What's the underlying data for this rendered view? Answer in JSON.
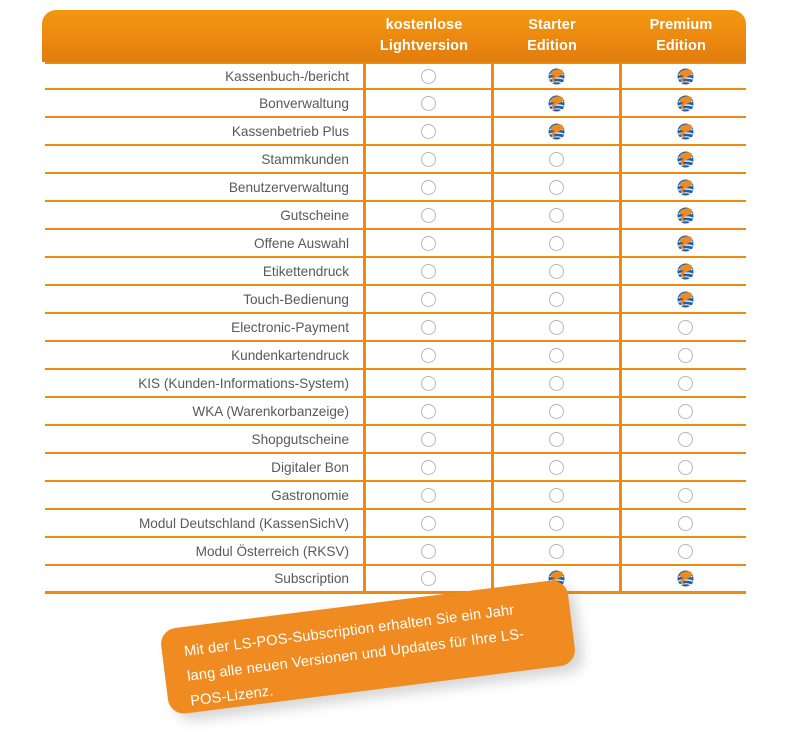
{
  "table": {
    "columns": [
      {
        "id": "feature",
        "label_lines": []
      },
      {
        "id": "light",
        "label_lines": [
          "kostenlose",
          "Lightversion"
        ]
      },
      {
        "id": "starter",
        "label_lines": [
          "Starter",
          "Edition"
        ]
      },
      {
        "id": "premium",
        "label_lines": [
          "Premium",
          "Edition"
        ]
      }
    ],
    "header": {
      "light_line1": "kostenlose",
      "light_line2": "Lightversion",
      "starter_line1": "Starter",
      "starter_line2": "Edition",
      "premium_line1": "Premium",
      "premium_line2": "Edition"
    },
    "marker_icons": {
      "included": "globe-icon",
      "not_included": "empty-circle-icon"
    },
    "rows": [
      {
        "feature": "Kassenbuch-/bericht",
        "light": false,
        "starter": true,
        "premium": true
      },
      {
        "feature": "Bonverwaltung",
        "light": false,
        "starter": true,
        "premium": true
      },
      {
        "feature": "Kassenbetrieb Plus",
        "light": false,
        "starter": true,
        "premium": true
      },
      {
        "feature": "Stammkunden",
        "light": false,
        "starter": false,
        "premium": true
      },
      {
        "feature": "Benutzerverwaltung",
        "light": false,
        "starter": false,
        "premium": true
      },
      {
        "feature": "Gutscheine",
        "light": false,
        "starter": false,
        "premium": true
      },
      {
        "feature": "Offene Auswahl",
        "light": false,
        "starter": false,
        "premium": true
      },
      {
        "feature": "Etikettendruck",
        "light": false,
        "starter": false,
        "premium": true
      },
      {
        "feature": "Touch-Bedienung",
        "light": false,
        "starter": false,
        "premium": true
      },
      {
        "feature": "Electronic-Payment",
        "light": false,
        "starter": false,
        "premium": false
      },
      {
        "feature": "Kundenkartendruck",
        "light": false,
        "starter": false,
        "premium": false
      },
      {
        "feature": "KIS (Kunden-Informations-System)",
        "light": false,
        "starter": false,
        "premium": false
      },
      {
        "feature": "WKA (Warenkorbanzeige)",
        "light": false,
        "starter": false,
        "premium": false
      },
      {
        "feature": "Shopgutscheine",
        "light": false,
        "starter": false,
        "premium": false
      },
      {
        "feature": "Digitaler Bon",
        "light": false,
        "starter": false,
        "premium": false
      },
      {
        "feature": "Gastronomie",
        "light": false,
        "starter": false,
        "premium": false
      },
      {
        "feature": "Modul Deutschland (KassenSichV)",
        "light": false,
        "starter": false,
        "premium": false
      },
      {
        "feature": "Modul Österreich (RKSV)",
        "light": false,
        "starter": false,
        "premium": false
      },
      {
        "feature": "Subscription",
        "light": false,
        "starter": true,
        "premium": true
      }
    ]
  },
  "callout": {
    "text": "Mit der LS-POS-Subscription erhalten Sie ein Jahr lang alle neuen Versionen und Updates für Ihre LS-POS-Lizenz."
  },
  "colors": {
    "accent_orange": "#ee8a0d",
    "header_orange_top": "#f2960f",
    "header_orange_bottom": "#e07d0e",
    "callout_orange": "#ef8b20",
    "text_gray": "#58595b",
    "marker_outline_gray": "#b6b7b9",
    "icon_blue": "#1f5fae",
    "icon_orange": "#ef8a1d"
  }
}
